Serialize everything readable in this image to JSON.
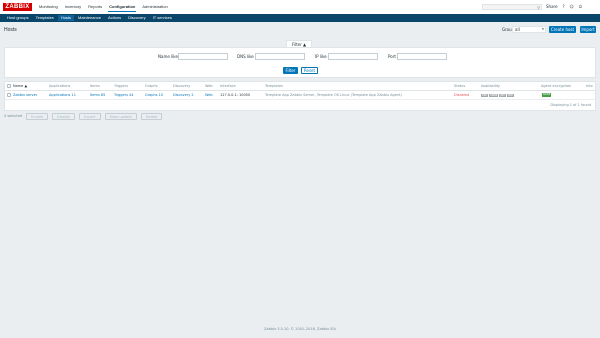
{
  "logo": "ZABBIX",
  "top_menu": [
    {
      "label": "Monitoring",
      "active": false
    },
    {
      "label": "Inventory",
      "active": false
    },
    {
      "label": "Reports",
      "active": false
    },
    {
      "label": "Configuration",
      "active": true
    },
    {
      "label": "Administration",
      "active": false
    }
  ],
  "header_icons": {
    "share_label": "Share",
    "help": "?",
    "user": "☺",
    "logout": "⏻"
  },
  "search": {
    "icon": "search-icon"
  },
  "sub_menu": [
    {
      "label": "Host groups",
      "active": false
    },
    {
      "label": "Templates",
      "active": false
    },
    {
      "label": "Hosts",
      "active": true
    },
    {
      "label": "Maintenance",
      "active": false
    },
    {
      "label": "Actions",
      "active": false
    },
    {
      "label": "Discovery",
      "active": false
    },
    {
      "label": "IT services",
      "active": false
    }
  ],
  "page": {
    "title": "Hosts",
    "group_label": "Group",
    "group_value": "all",
    "create_button": "Create host",
    "import_button": "Import"
  },
  "filter": {
    "tab_label": "Filter ▲",
    "name_label": "Name like",
    "dns_label": "DNS like",
    "ip_label": "IP like",
    "port_label": "Port",
    "apply": "Filter",
    "reset": "Reset"
  },
  "table": {
    "headers": [
      "Name ▲",
      "Applications",
      "Items",
      "Triggers",
      "Graphs",
      "Discovery",
      "Web",
      "Interface",
      "Templates",
      "Status",
      "Availability",
      "Agent encryption",
      "Info"
    ],
    "row": {
      "name": "Zabbix server",
      "applications": "Applications 11",
      "items": "Items 65",
      "triggers": "Triggers 44",
      "graphs": "Graphs 10",
      "discovery": "Discovery 2",
      "web": "Web",
      "interface": "127.0.0.1: 10050",
      "templates": "Template App Zabbix Server, Template OS Linux (Template App Zabbix Agent)",
      "status": "Disabled",
      "availability": [
        "ZBX",
        "SNMP",
        "JMX",
        "IPMI"
      ],
      "encryption": "NONE"
    },
    "displaying": "Displaying 1 of 1 found"
  },
  "actions": {
    "selected": "0 selected",
    "buttons": [
      "Enable",
      "Disable",
      "Export",
      "Mass update",
      "Delete"
    ]
  },
  "footer": "Zabbix 3.0.10. © 2001–2016, Zabbix SIA"
}
